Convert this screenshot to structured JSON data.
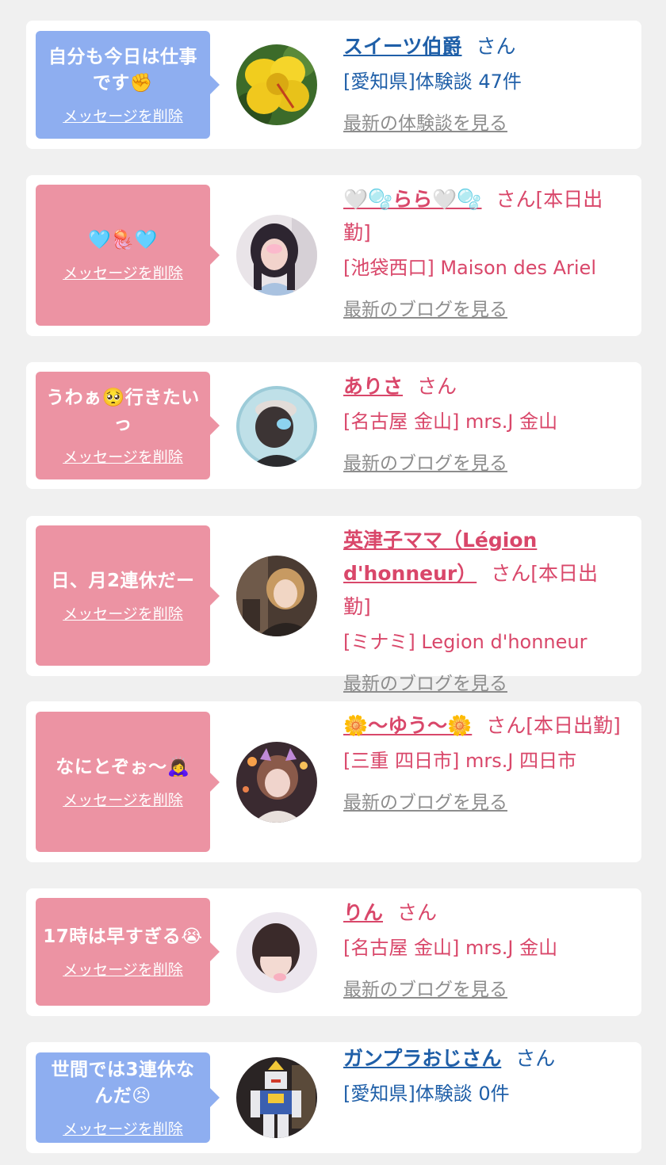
{
  "items": [
    {
      "message": "自分も今日は仕事です✊",
      "delete_label": "メッセージを削除",
      "name": "スイーツ伯爵",
      "suffix": "さん",
      "shop": "[愛知県]体験談 47件",
      "more": "最新の体験談を見る",
      "avatar": "hibiscus-flower-avatar"
    },
    {
      "message": "🩵🪼🩵",
      "delete_label": "メッセージを削除",
      "name": "🤍🫧らら🤍🫧",
      "suffix": "さん[本日出勤]",
      "shop": "[池袋西口] Maison des Ariel",
      "more": "最新のブログを見る",
      "avatar": "girl-selfie-avatar"
    },
    {
      "message": "うわぁ🥺行きたいっ",
      "delete_label": "メッセージを削除",
      "name": "ありさ",
      "suffix": "さん",
      "shop": "[名古屋 金山] mrs.J 金山",
      "more": "最新のブログを見る",
      "avatar": "girl-cap-avatar"
    },
    {
      "message": "日、月2連休だー",
      "delete_label": "メッセージを削除",
      "name": "英津子ママ（Légion d'honneur）",
      "suffix": "さん[本日出勤]",
      "shop": "[ミナミ] Legion d'honneur",
      "more": "最新のブログを見る",
      "avatar": "woman-portrait-avatar"
    },
    {
      "message": "なにとぞぉ〜🙇‍♀️",
      "delete_label": "メッセージを削除",
      "name": "🌼〜ゆう〜🌼",
      "suffix": "さん[本日出勤]",
      "shop": "[三重 四日市] mrs.J 四日市",
      "more": "最新のブログを見る",
      "avatar": "girl-cat-ears-avatar"
    },
    {
      "message": "17時は早すぎる😭",
      "delete_label": "メッセージを削除",
      "name": "りん",
      "suffix": "さん",
      "shop": "[名古屋 金山] mrs.J 金山",
      "more": "最新のブログを見る",
      "avatar": "girl-bangs-avatar"
    },
    {
      "message": "世間では3連休なんだ😣",
      "delete_label": "メッセージを削除",
      "name": "ガンプラおじさん",
      "suffix": "さん",
      "shop": "[愛知県]体験談 0件",
      "more": "",
      "avatar": "gundam-model-avatar"
    }
  ],
  "colors": {
    "blue_bubble": "#8eaef0",
    "pink_bubble": "#ec93a3",
    "blue_text": "#1f5fa8",
    "pink_text": "#d9476a",
    "link_gray": "#8d8d8d",
    "page_bg": "#f0f0f0"
  }
}
